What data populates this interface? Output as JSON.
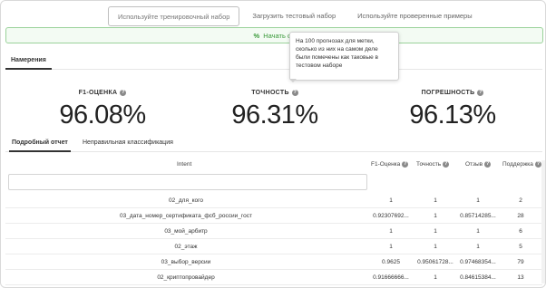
{
  "modes": [
    {
      "label": "Используйте тренировочный набор",
      "active": true
    },
    {
      "label": "Загрузить тестовый набор",
      "active": false
    },
    {
      "label": "Используйте проверенные примеры",
      "active": false
    }
  ],
  "startbar": {
    "icon": "%",
    "label": "Начать оц"
  },
  "subtab": {
    "label": "Намерения"
  },
  "tooltip": {
    "text": "На 100 прогнозах для метки, сколько из них на самом деле были помечены как таковые в тестовом наборе"
  },
  "metrics": {
    "f1": {
      "label": "F1-ОЦЕНКА",
      "value": "96.08%"
    },
    "precision": {
      "label": "ТОЧНОСТЬ",
      "value": "96.31%"
    },
    "recall": {
      "label": "ПОГРЕШНОСТЬ",
      "value": "96.13%"
    }
  },
  "report_tabs": [
    {
      "label": "Подробный отчет",
      "active": true
    },
    {
      "label": "Неправильная классификация",
      "active": false
    }
  ],
  "table": {
    "headers": {
      "intent": "Intent",
      "f1": "F1-Оценка",
      "precision": "Точность",
      "recall": "Отзыв",
      "support": "Поддержка"
    },
    "filter_value": "",
    "rows": [
      {
        "intent": "02_для_кого",
        "f1": "1",
        "precision": "1",
        "recall": "1",
        "support": "2"
      },
      {
        "intent": "03_дата_номер_сертификата_фсб_россии_гост",
        "f1": "0.92307692...",
        "precision": "1",
        "recall": "0.85714285...",
        "support": "28"
      },
      {
        "intent": "03_мой_арбитр",
        "f1": "1",
        "precision": "1",
        "recall": "1",
        "support": "6"
      },
      {
        "intent": "02_этаж",
        "f1": "1",
        "precision": "1",
        "recall": "1",
        "support": "5"
      },
      {
        "intent": "03_выбор_версии",
        "f1": "0.9625",
        "precision": "0.95061728...",
        "recall": "0.97468354...",
        "support": "79"
      },
      {
        "intent": "02_криптопровайдер",
        "f1": "0.91666666...",
        "precision": "1",
        "recall": "0.84615384...",
        "support": "13"
      }
    ]
  }
}
